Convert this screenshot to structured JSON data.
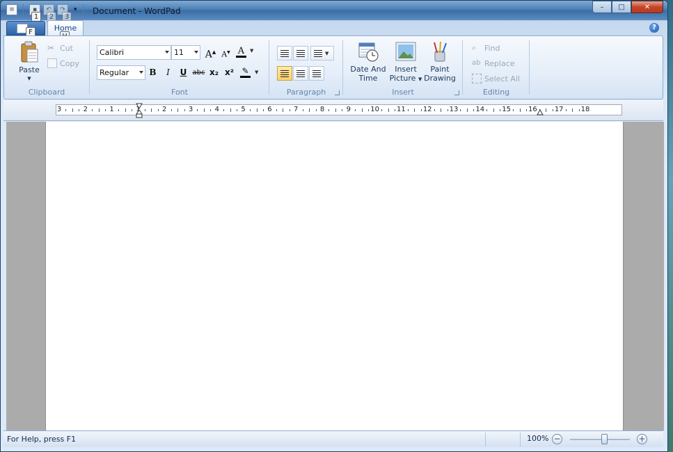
{
  "window": {
    "title": "Document - WordPad",
    "minimize_glyph": "–",
    "maximize_glyph": "□",
    "close_glyph": "✕"
  },
  "keytips": {
    "save": "1",
    "undo": "2",
    "redo": "3",
    "file": "F",
    "home": "H"
  },
  "tabs": {
    "home": "Home"
  },
  "clipboard": {
    "label": "Clipboard",
    "paste": "Paste",
    "cut": "Cut",
    "copy": "Copy"
  },
  "font": {
    "label": "Font",
    "family": "Calibri",
    "size": "11",
    "style": "Regular",
    "grow_glyph": "A",
    "shrink_glyph": "A",
    "color_glyph": "A",
    "bold": "B",
    "italic": "I",
    "underline": "U",
    "strike": "abc",
    "subscript": "x₂",
    "superscript": "x²"
  },
  "paragraph": {
    "label": "Paragraph"
  },
  "insert": {
    "label": "Insert",
    "date_time": "Date And Time",
    "date_time_line1": "Date And",
    "date_time_line2": "Time",
    "picture_line1": "Insert",
    "picture_line2": "Picture",
    "paint_line1": "Paint",
    "paint_line2": "Drawing"
  },
  "editing": {
    "label": "Editing",
    "find": "Find",
    "replace": "Replace",
    "select_all": "Select All"
  },
  "ruler": {
    "labels": [
      "3",
      "2",
      "1",
      "1",
      "2",
      "3",
      "4",
      "5",
      "6",
      "7",
      "8",
      "9",
      "10",
      "11",
      "12",
      "13",
      "14",
      "15",
      "16",
      "17",
      "18"
    ]
  },
  "status": {
    "help": "For Help, press F1",
    "zoom": "100%",
    "zoom_percent": 100,
    "zoom_out_glyph": "−",
    "zoom_in_glyph": "+"
  },
  "colors": {
    "accent": "#15428b",
    "font_color_bar": "#000000",
    "highlight_bar": "#000000",
    "page": "#ffffff",
    "workspace": "#ababab"
  }
}
